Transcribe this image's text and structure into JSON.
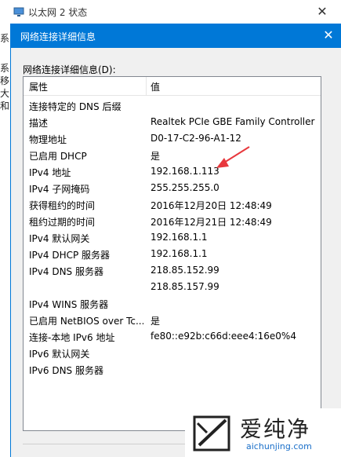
{
  "background_window": {
    "title": "以太网 2 状态",
    "fragments": [
      "系",
      "系",
      "移",
      "大",
      "和"
    ]
  },
  "dialog": {
    "title": "网络连接详细信息",
    "list_label": "网络连接详细信息(D):",
    "columns": {
      "property": "属性",
      "value": "值"
    },
    "rows": [
      {
        "property": "连接特定的 DNS 后缀",
        "value": ""
      },
      {
        "property": "描述",
        "value": "Realtek PCIe GBE Family Controller"
      },
      {
        "property": "物理地址",
        "value": "D0-17-C2-96-A1-12"
      },
      {
        "property": "已启用 DHCP",
        "value": "是"
      },
      {
        "property": "IPv4 地址",
        "value": "192.168.1.113"
      },
      {
        "property": "IPv4 子网掩码",
        "value": "255.255.255.0"
      },
      {
        "property": "获得租约的时间",
        "value": "2016年12月20日 12:48:49"
      },
      {
        "property": "租约过期的时间",
        "value": "2016年12月21日 12:48:49"
      },
      {
        "property": "IPv4 默认网关",
        "value": "192.168.1.1"
      },
      {
        "property": "IPv4 DHCP 服务器",
        "value": "192.168.1.1"
      },
      {
        "property": "IPv4 DNS 服务器",
        "value": "218.85.152.99"
      },
      {
        "property": "",
        "value": "218.85.157.99"
      },
      {
        "property": "IPv4 WINS 服务器",
        "value": ""
      },
      {
        "property": "已启用 NetBIOS over Tc...",
        "value": "是"
      },
      {
        "property": "连接-本地 IPv6 地址",
        "value": "fe80::e92b:c66d:eee4:16e0%4"
      },
      {
        "property": "IPv6 默认网关",
        "value": ""
      },
      {
        "property": "IPv6 DNS 服务器",
        "value": ""
      }
    ]
  },
  "watermark": {
    "name": "爱纯净",
    "url": "aichunjing.com"
  },
  "colors": {
    "accent": "#0078d7",
    "arrow": "#e8383d"
  }
}
